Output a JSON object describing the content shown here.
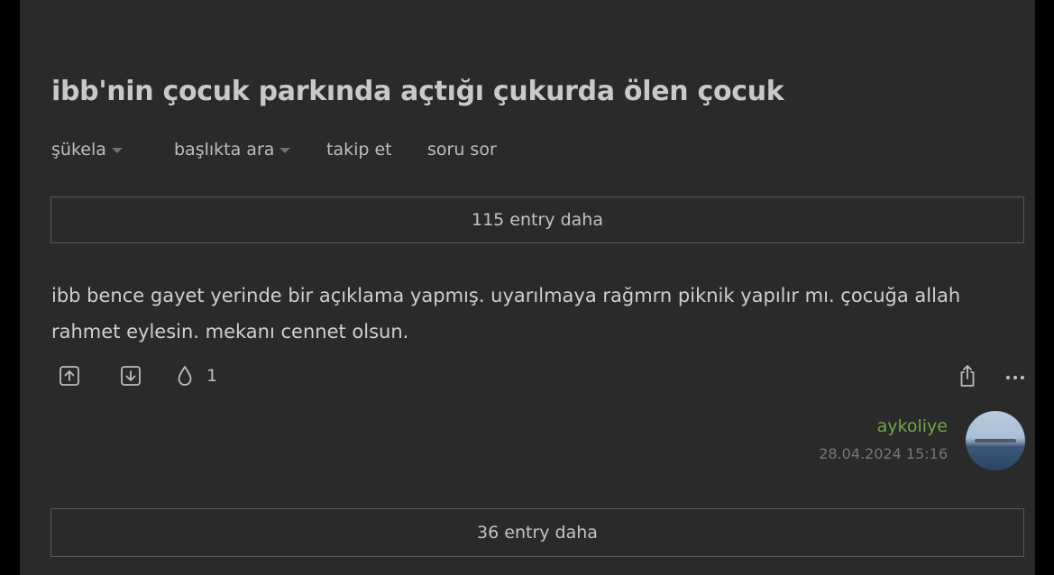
{
  "topic": {
    "title": "ibb'nin çocuk parkında açtığı çukurda ölen çocuk"
  },
  "nav": {
    "sort_label": "şükela",
    "search_label": "başlıkta ara",
    "follow_label": "takip et",
    "ask_label": "soru sor"
  },
  "more_before": "115 entry daha",
  "entry": {
    "content": "ibb bence gayet yerinde bir açıklama yapmış. uyarılmaya rağmrn piknik yapılır mı. çocuğa allah rahmet eylesin. mekanı cennet olsun.",
    "fav_count": "1",
    "author": "aykoliye",
    "date": "28.04.2024 15:16"
  },
  "more_after": "36 entry daha",
  "icons": {
    "upvote": "upvote-icon",
    "downvote": "downvote-icon",
    "favorite": "drop-icon",
    "share": "share-icon",
    "more": "more-icon"
  },
  "colors": {
    "background": "#2a2a2b",
    "text": "#cfcfcf",
    "author": "#6fa74a",
    "border": "#5a5a5a"
  }
}
